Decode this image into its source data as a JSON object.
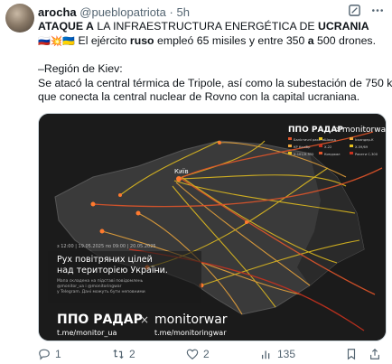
{
  "author": {
    "name": "arocha",
    "handle": "@pueblopatriota",
    "separator": "·",
    "time": "5h"
  },
  "tweet": {
    "headline_a": "ATAQUE A",
    "headline_b": " LA INFRAESTRUCTURA ENERGÉTICA DE ",
    "headline_c": "UCRANIA",
    "flags": "🇷🇺💥🇺🇦",
    "line2_a": " El ejército ",
    "line2_b": "ruso",
    "line2_c": " empleó 65 misiles y entre 350 ",
    "line2_d": "a",
    "line2_e": " 500 drones.",
    "region": "–Región de Kiev:",
    "detail_1": "Se atacó la central térmica de Tripole, así como la subestación de 750 kV",
    "detail_2": "que conecta la central nuclear de Rovno con la capital ucraniana."
  },
  "media": {
    "brand_top": "ППО РАДАР",
    "cross": "×",
    "brand_top_2": "monitorwar",
    "map_city": "Київ",
    "dates": "з 12:00 | 19.05.2025 по 09:00 | 20.05.2025",
    "caption_1": "Рух повітряних цілей",
    "caption_2": "над територією України.",
    "small_1": "Мапа складена на підставі повідомлень",
    "small_2": "@monitor_ua і @monitoringwar",
    "small_3": "у Telegram. Дані можуть бути неповними",
    "brand_bottom": "ППО РАДАР",
    "brand_bottom_2": "monitorwar",
    "link_1": "t.me/monitor_ua",
    "link_2": "t.me/monitoringwar",
    "legend": [
      "Балістичні ракети",
      "КР Калібр",
      "Х-101/Х-555",
      "Шахед",
      "Х-22",
      "Кинджал",
      "Іскандер-К",
      "Х-59/69",
      "Ракети С-300"
    ],
    "colors": {
      "shahed": "#e8c21e",
      "missile": "#e0552a",
      "track": "#f2a93b"
    }
  },
  "actions": {
    "replies": "1",
    "reposts": "2",
    "likes": "2",
    "views": "135"
  },
  "icons": [
    "more-icon",
    "grok-icon",
    "reply-icon",
    "repost-icon",
    "like-icon",
    "views-icon",
    "bookmark-icon",
    "share-icon"
  ]
}
